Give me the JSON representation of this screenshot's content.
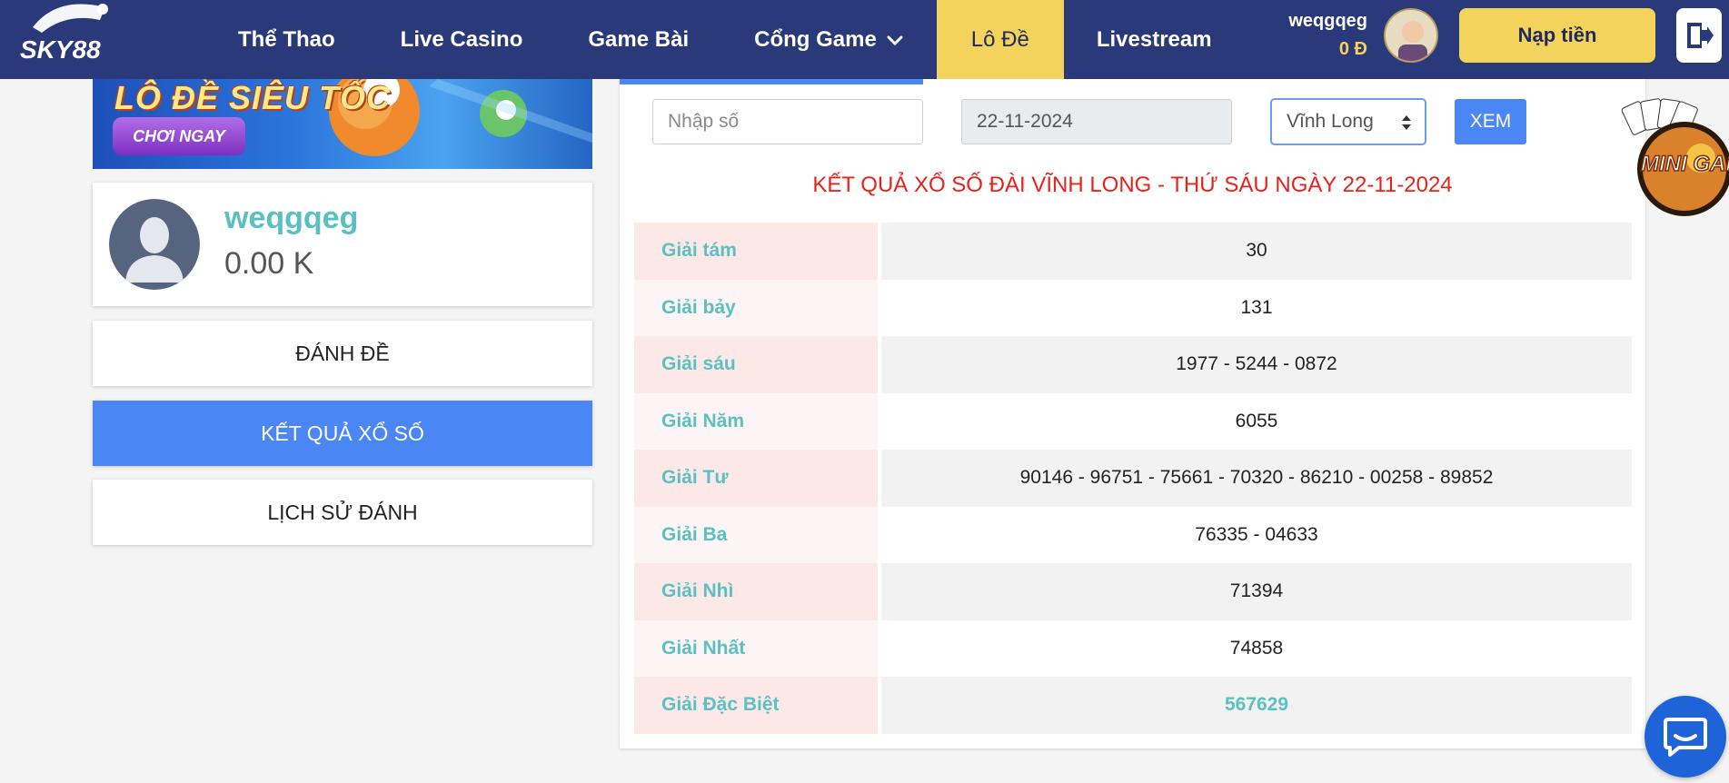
{
  "header": {
    "logo_text": "SKY88",
    "nav": [
      {
        "label": "Thể Thao"
      },
      {
        "label": "Live Casino"
      },
      {
        "label": "Game Bài"
      },
      {
        "label": "Cổng Game"
      },
      {
        "label": "Lô Đề"
      },
      {
        "label": "Livestream"
      }
    ],
    "username": "weqgqeg",
    "balance": "0 Đ",
    "deposit_label": "Nạp tiền"
  },
  "banner": {
    "title": "LÔ ĐỀ SIÊU TỐC",
    "cta": "CHƠI NGAY"
  },
  "profile": {
    "name": "weqgqeg",
    "balance": "0.00 K"
  },
  "menu": [
    {
      "label": "ĐÁNH ĐỀ"
    },
    {
      "label": "KẾT QUẢ XỔ SỐ"
    },
    {
      "label": "LỊCH SỬ ĐÁNH"
    }
  ],
  "filters": {
    "number_placeholder": "Nhập số",
    "date": "22-11-2024",
    "province": "Vĩnh Long",
    "view_label": "XEM"
  },
  "result_title": "KẾT QUẢ XỔ SỐ ĐÀI VĨNH LONG - THỨ SÁU NGÀY 22-11-2024",
  "prizes": [
    {
      "label": "Giải tám",
      "value": "30"
    },
    {
      "label": "Giải bảy",
      "value": "131"
    },
    {
      "label": "Giải sáu",
      "value": "1977 - 5244 - 0872"
    },
    {
      "label": "Giải Năm",
      "value": "6055"
    },
    {
      "label": "Giải Tư",
      "value": "90146 - 96751 - 75661 - 70320 - 86210 - 00258 - 89852"
    },
    {
      "label": "Giải Ba",
      "value": "76335 - 04633"
    },
    {
      "label": "Giải Nhì",
      "value": "71394"
    },
    {
      "label": "Giải Nhất",
      "value": "74858"
    },
    {
      "label": "Giải Đặc Biệt",
      "value": "567629"
    }
  ],
  "widgets": {
    "mini_game_label": "MINI GAME"
  },
  "colors": {
    "header_bg": "#2a3979",
    "accent_yellow": "#f4d35c",
    "primary_blue": "#4a87f4",
    "teal": "#5ac0c2",
    "title_red": "#e5231b"
  }
}
